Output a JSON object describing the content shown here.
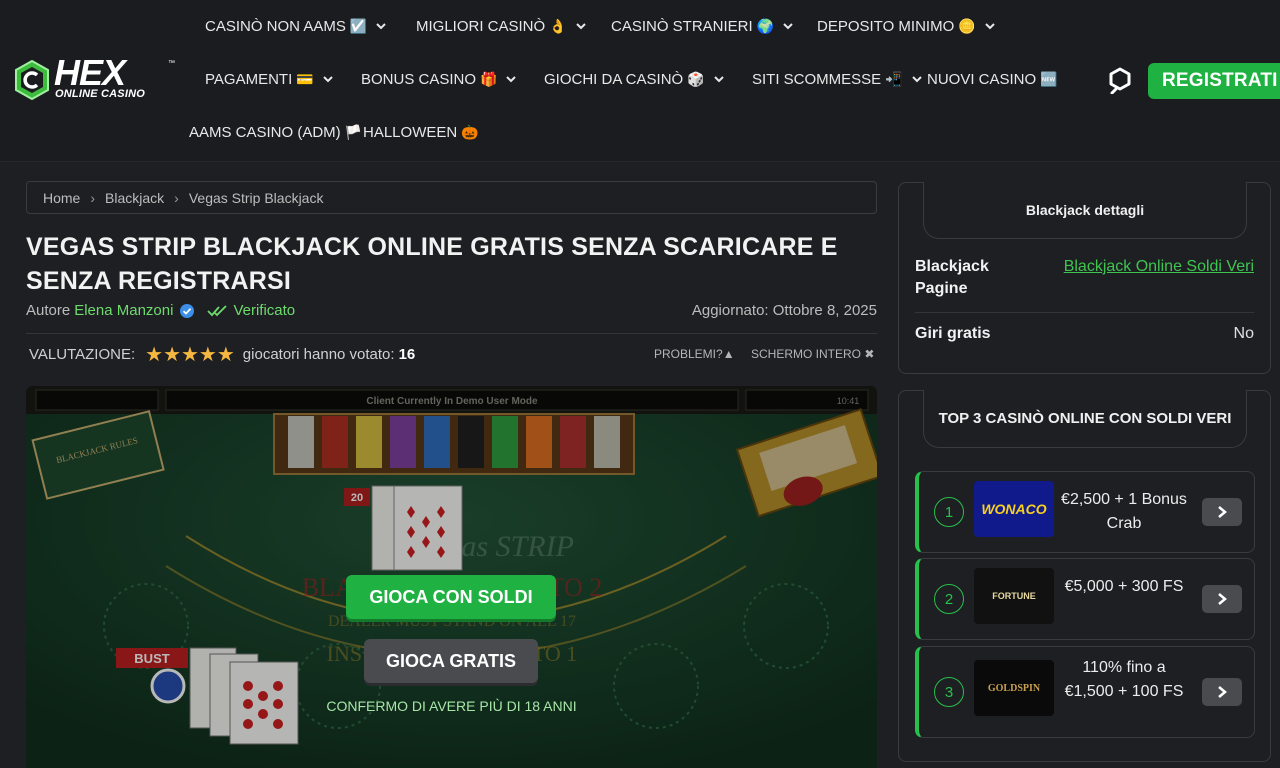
{
  "brand": {
    "logo_word": "HEX",
    "logo_sub": "ONLINE CASINO",
    "logo_tm": "™"
  },
  "nav": {
    "row1": [
      {
        "label": "CASINÒ NON AAMS",
        "emoji": "☑️",
        "has_menu": true
      },
      {
        "label": "MIGLIORI CASINÒ",
        "emoji": "👌",
        "has_menu": true
      },
      {
        "label": "CASINÒ STRANIERI",
        "emoji": "🌍",
        "has_menu": true
      },
      {
        "label": "DEPOSITO MINIMO",
        "emoji": "🪙",
        "has_menu": true
      }
    ],
    "row2": [
      {
        "label": "PAGAMENTI",
        "emoji": "💳",
        "has_menu": true
      },
      {
        "label": "BONUS CASINO",
        "emoji": "🎁",
        "has_menu": true
      },
      {
        "label": "GIOCHI DA CASINÒ",
        "emoji": "🎲",
        "has_menu": true
      },
      {
        "label": "SITI SCOMMESSE",
        "emoji": "📲",
        "has_menu": true
      },
      {
        "label": "NUOVI CASINO",
        "emoji": "🆕",
        "has_menu": false
      }
    ],
    "row3": [
      {
        "label": "AAMS CASINO (ADM)",
        "emoji": "🏳️"
      },
      {
        "label": "HALLOWEEN",
        "emoji": "🎃"
      }
    ],
    "register_label": "REGISTRATI",
    "search_icon": "search-icon"
  },
  "breadcrumb": [
    "Home",
    "Blackjack",
    "Vegas Strip Blackjack"
  ],
  "article": {
    "title": "VEGAS STRIP BLACKJACK ONLINE GRATIS SENZA SCARICARE E SENZA REGISTRARSI",
    "author_prefix": "Autore",
    "author": "Elena Manzoni",
    "verified_label": "Verificato",
    "updated": "Aggiornato: Ottobre 8, 2025",
    "rating_label": "VALUTAZIONE:",
    "stars": "★★★★★",
    "rating_value": 5,
    "votes_label": "giocatori hanno votato:",
    "votes_count": "16",
    "problems_label": "PROBLEMI?",
    "fullscreen_label": "SCHERMO INTERO"
  },
  "game": {
    "top_bar_text": "Client Currently In Demo User Mode",
    "clock": "10:41",
    "play_money_label": "GIOCA CON SOLDI",
    "play_free_label": "GIOCA GRATIS",
    "age_confirm": "CONFERMO DI AVERE PIÙ DI 18 ANNI",
    "dealer_score": "20",
    "player_status": "BUST",
    "rules_sign": "BLACKJACK RULES",
    "table_text_1": "BLACKJACK PAYS 3 TO 2",
    "table_text_2": "DEALER MUST STAND ON ALL 17",
    "table_text_3": "INSURANCE PAYS 2 TO 1",
    "table_logo": "Vegas STRIP"
  },
  "sidebar": {
    "details": {
      "title": "Blackjack dettagli",
      "rows": [
        {
          "label": "Blackjack Pagine",
          "value": "Blackjack Online Soldi Veri",
          "is_link": true
        },
        {
          "label": "Giri gratis",
          "value": "No",
          "is_link": false
        }
      ]
    },
    "top3": {
      "title": "TOP 3 CASINÒ ONLINE CON SOLDI VERI",
      "items": [
        {
          "rank": "1",
          "logo_text": "WONACO",
          "bonus": "€2,500 + 1 Bonus Crab"
        },
        {
          "rank": "2",
          "logo_text": "FORTUNE",
          "bonus": "€5,000 + 300 FS"
        },
        {
          "rank": "3",
          "logo_text": "GOLDSPIN",
          "bonus": "110% fino a €1,500 + 100 FS"
        }
      ]
    }
  },
  "colors": {
    "accent_green": "#1fb141",
    "link_green": "#3fc450",
    "star": "#f5b740",
    "bg": "#1e1f23"
  }
}
